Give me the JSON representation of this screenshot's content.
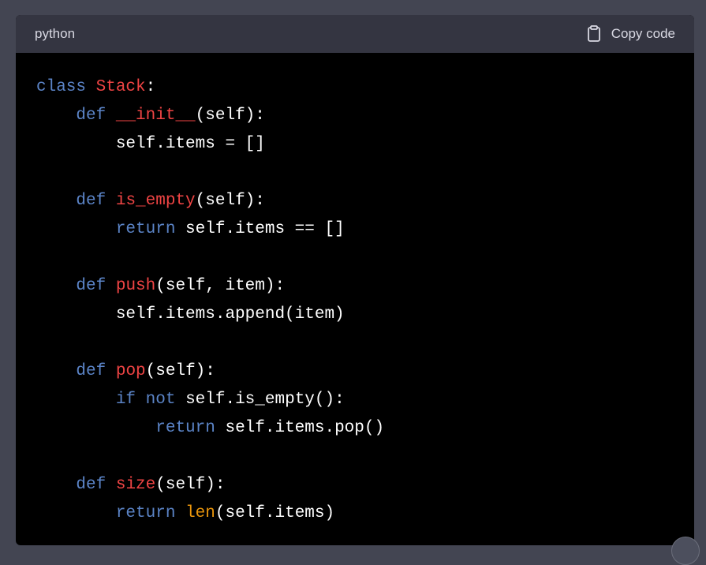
{
  "header": {
    "language": "python",
    "copy_label": "Copy code",
    "copy_icon": "clipboard-icon"
  },
  "colors": {
    "keyword": "#5b84c7",
    "function_name": "#ef4444",
    "builtin": "#e9950c",
    "text": "#ffffff",
    "header_bg": "#343541",
    "code_bg": "#000000"
  },
  "code": [
    [
      {
        "t": "class",
        "c": "kw"
      },
      {
        "t": " ",
        "c": "plain"
      },
      {
        "t": "Stack",
        "c": "fn"
      },
      {
        "t": ":",
        "c": "plain"
      }
    ],
    [
      {
        "t": "    ",
        "c": "plain"
      },
      {
        "t": "def",
        "c": "kw"
      },
      {
        "t": " ",
        "c": "plain"
      },
      {
        "t": "__init__",
        "c": "fn"
      },
      {
        "t": "(self):",
        "c": "plain"
      }
    ],
    [
      {
        "t": "        self.items = []",
        "c": "plain"
      }
    ],
    [],
    [
      {
        "t": "    ",
        "c": "plain"
      },
      {
        "t": "def",
        "c": "kw"
      },
      {
        "t": " ",
        "c": "plain"
      },
      {
        "t": "is_empty",
        "c": "fn"
      },
      {
        "t": "(self):",
        "c": "plain"
      }
    ],
    [
      {
        "t": "        ",
        "c": "plain"
      },
      {
        "t": "return",
        "c": "kw"
      },
      {
        "t": " self.items == []",
        "c": "plain"
      }
    ],
    [],
    [
      {
        "t": "    ",
        "c": "plain"
      },
      {
        "t": "def",
        "c": "kw"
      },
      {
        "t": " ",
        "c": "plain"
      },
      {
        "t": "push",
        "c": "fn"
      },
      {
        "t": "(self, item):",
        "c": "plain"
      }
    ],
    [
      {
        "t": "        self.items.append(item)",
        "c": "plain"
      }
    ],
    [],
    [
      {
        "t": "    ",
        "c": "plain"
      },
      {
        "t": "def",
        "c": "kw"
      },
      {
        "t": " ",
        "c": "plain"
      },
      {
        "t": "pop",
        "c": "fn"
      },
      {
        "t": "(self):",
        "c": "plain"
      }
    ],
    [
      {
        "t": "        ",
        "c": "plain"
      },
      {
        "t": "if",
        "c": "kw"
      },
      {
        "t": " ",
        "c": "plain"
      },
      {
        "t": "not",
        "c": "kw"
      },
      {
        "t": " self.is_empty():",
        "c": "plain"
      }
    ],
    [
      {
        "t": "            ",
        "c": "plain"
      },
      {
        "t": "return",
        "c": "kw"
      },
      {
        "t": " self.items.pop()",
        "c": "plain"
      }
    ],
    [],
    [
      {
        "t": "    ",
        "c": "plain"
      },
      {
        "t": "def",
        "c": "kw"
      },
      {
        "t": " ",
        "c": "plain"
      },
      {
        "t": "size",
        "c": "fn"
      },
      {
        "t": "(self):",
        "c": "plain"
      }
    ],
    [
      {
        "t": "        ",
        "c": "plain"
      },
      {
        "t": "return",
        "c": "kw"
      },
      {
        "t": " ",
        "c": "plain"
      },
      {
        "t": "len",
        "c": "bi"
      },
      {
        "t": "(self.items)",
        "c": "plain"
      }
    ]
  ]
}
